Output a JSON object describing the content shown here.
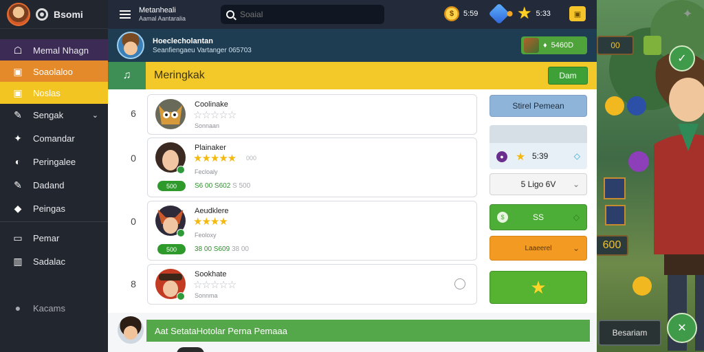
{
  "topbar": {
    "title": "Metanheali",
    "subtitle": "Aamal Aantaralia",
    "search_placeholder": "Soaial",
    "resources": [
      {
        "icon": "coin-icon",
        "value": "5:59"
      },
      {
        "icon": "gem-icon",
        "value": ""
      },
      {
        "icon": "star-icon",
        "value": "5:33"
      },
      {
        "icon": "chest-icon",
        "value": ""
      }
    ]
  },
  "sidebar": {
    "brand": "Bsomi",
    "items": [
      {
        "icon": "user-icon",
        "label": "Memal Nhagn"
      },
      {
        "icon": "grid-icon",
        "label": "Soaolaloo"
      },
      {
        "icon": "grid-icon",
        "label": "Noslas"
      },
      {
        "icon": "tool-icon",
        "label": "Sengak"
      },
      {
        "icon": "pin-icon",
        "label": "Comandar"
      },
      {
        "icon": "info-icon",
        "label": "Peringalee"
      },
      {
        "icon": "tool-icon",
        "label": "Dadand"
      },
      {
        "icon": "chat-icon",
        "label": "Peingas"
      },
      {
        "icon": "window-icon",
        "label": "Pemar"
      },
      {
        "icon": "chart-icon",
        "label": "Sadalac"
      },
      {
        "icon": "info-icon",
        "label": "Kacams"
      }
    ]
  },
  "profile": {
    "name": "Hoeclecholantan",
    "sub": "Seanfiengaeu Vartanger 065703",
    "currency": "5460D"
  },
  "section": {
    "title": "Meringkak",
    "done_label": "Dam"
  },
  "rows": [
    {
      "num": "6",
      "name": "Coolinake",
      "sub": "Sonnaan",
      "stars_on": 0
    },
    {
      "num": "0",
      "name": "Plainaker",
      "sub": "Fecloaly",
      "stars_on": 5,
      "extra": "000",
      "pill": "500",
      "scores": "S6 00 S602",
      "scores_muted": "S 500"
    },
    {
      "num": "0",
      "name": "Aeudklere",
      "sub": "Feoloxy",
      "stars_on": 4,
      "extra": "",
      "pill": "500",
      "scores": "38 00 S609",
      "scores_muted": "38 00"
    },
    {
      "num": "8",
      "name": "Sookhate",
      "sub": "Sonnma",
      "stars_on": 0
    }
  ],
  "right": {
    "btn1": "Stirel Pemean",
    "btn2_value": "5:39",
    "btn3_value": "5 Ligo 6V",
    "btn4_value": "SS",
    "btn5_value": "Laaeerel",
    "colors": {
      "green": "#4cae36",
      "orange": "#f39a23",
      "blue": "#8fb4d9"
    }
  },
  "footer": {
    "banner": "Aat SetataHotolar Perna Pemaaa"
  },
  "game": {
    "counter": "00",
    "chip_value": "600",
    "bottom_button": "Besariam"
  }
}
